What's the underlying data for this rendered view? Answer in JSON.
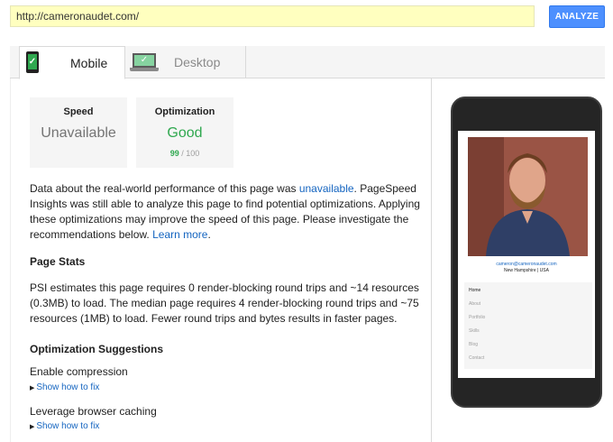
{
  "url_bar": {
    "value": "http://cameronaudet.com/",
    "button_label": "ANALYZE"
  },
  "tabs": [
    {
      "label": "Mobile",
      "active": true,
      "icon": "mobile-phone-check-icon"
    },
    {
      "label": "Desktop",
      "active": false,
      "icon": "laptop-check-icon"
    }
  ],
  "score_cards": {
    "speed": {
      "title": "Speed",
      "value": "Unavailable"
    },
    "optimization": {
      "title": "Optimization",
      "value": "Good",
      "score": "99",
      "score_suffix": " / 100"
    }
  },
  "intro": {
    "text_1": "Data about the real-world performance of this page was ",
    "link_1": "unavailable",
    "text_2": ". PageSpeed Insights was still able to analyze this page to find potential optimizations. Applying these optimizations may improve the speed of this page. Please investigate the recommendations below. ",
    "link_2": "Learn more",
    "text_3": "."
  },
  "page_stats": {
    "heading": "Page Stats",
    "text": "PSI estimates this page requires 0 render-blocking round trips and ~14 resources (0.3MB) to load. The median page requires 4 render-blocking round trips and ~75 resources (1MB) to load. Fewer round trips and bytes results in faster pages."
  },
  "suggestions": {
    "heading": "Optimization Suggestions",
    "items": [
      {
        "title": "Enable compression",
        "link": "Show how to fix"
      },
      {
        "title": "Leverage browser caching",
        "link": "Show how to fix"
      }
    ]
  },
  "preview": {
    "email": "cameron@cameronaudet.com",
    "location": "New Hampshire | USA",
    "nav": [
      "Home",
      "About",
      "Portfolio",
      "Skills",
      "Blog",
      "Contact"
    ]
  },
  "colors": {
    "accent": "#4d90fe",
    "good": "#2fa84f",
    "link": "#1565c0",
    "url_bg": "#ffffbf"
  }
}
